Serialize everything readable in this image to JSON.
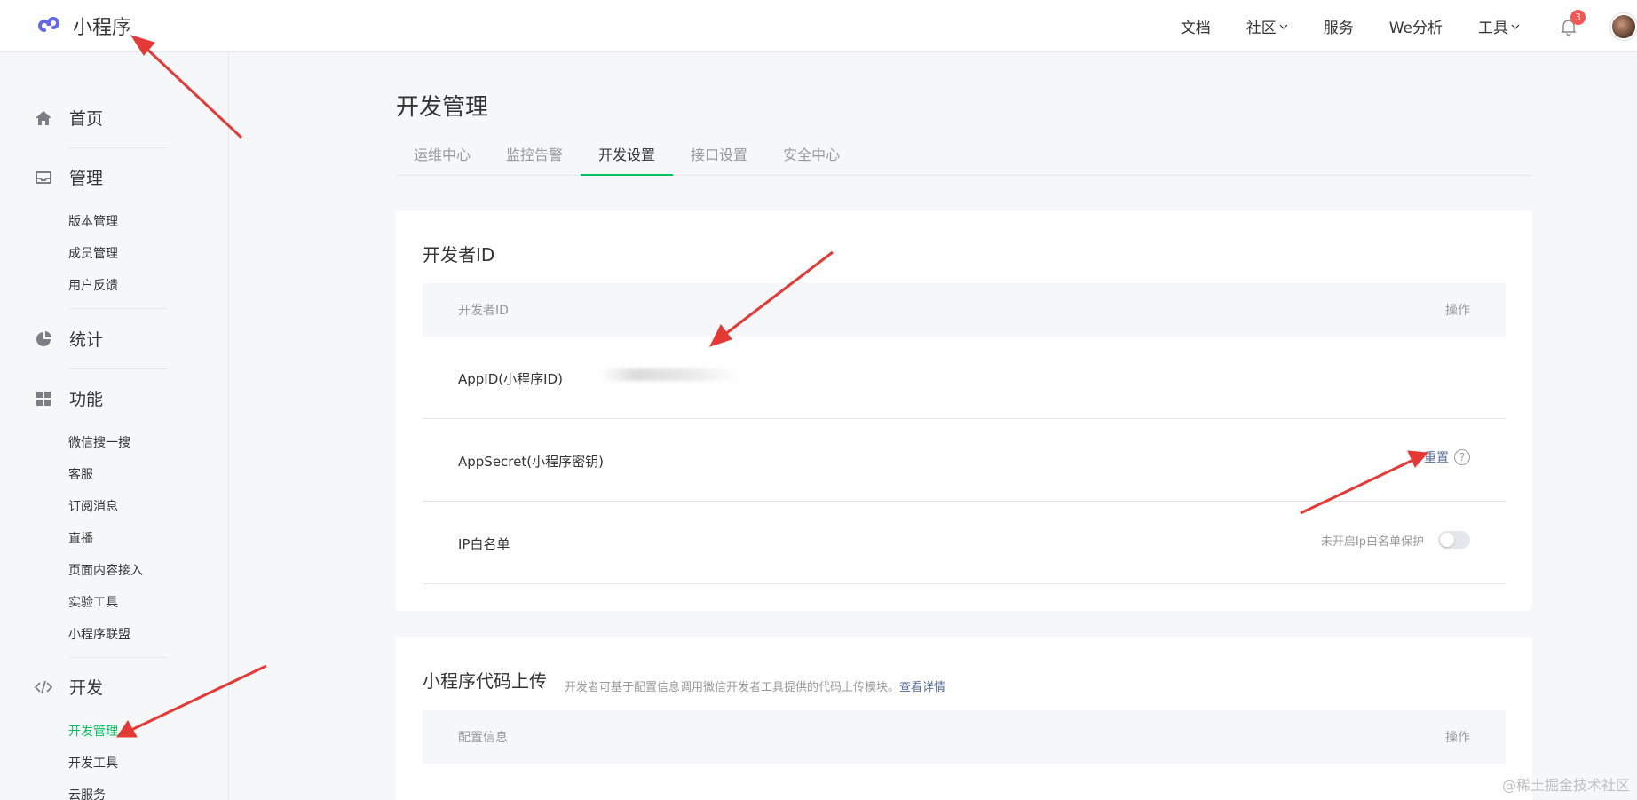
{
  "header": {
    "app_name": "小程序",
    "nav": [
      "文档",
      "社区",
      "服务",
      "We分析",
      "工具"
    ],
    "notification_count": "3"
  },
  "sidebar": {
    "home": "首页",
    "manage": {
      "label": "管理",
      "items": [
        "版本管理",
        "成员管理",
        "用户反馈"
      ]
    },
    "stats": "统计",
    "features": {
      "label": "功能",
      "items": [
        "微信搜一搜",
        "客服",
        "订阅消息",
        "直播",
        "页面内容接入",
        "实验工具",
        "小程序联盟"
      ]
    },
    "dev": {
      "label": "开发",
      "items": [
        "开发管理",
        "开发工具",
        "云服务"
      ],
      "active_index": 0
    }
  },
  "main": {
    "title": "开发管理",
    "tabs": [
      "运维中心",
      "监控告警",
      "开发设置",
      "接口设置",
      "安全中心"
    ],
    "active_tab": 2
  },
  "developer_card": {
    "title": "开发者ID",
    "col_left": "开发者ID",
    "col_right": "操作",
    "rows": {
      "appid_label": "AppID(小程序ID)",
      "secret_label": "AppSecret(小程序密钥)",
      "secret_action": "重置",
      "ip_label": "IP白名单",
      "ip_status": "未开启Ip白名单保护"
    }
  },
  "upload_card": {
    "title": "小程序代码上传",
    "desc": "开发者可基于配置信息调用微信开发者工具提供的代码上传模块。",
    "desc_link": "查看详情",
    "col_left": "配置信息",
    "col_right": "操作"
  },
  "watermark": "@稀土掘金技术社区",
  "colors": {
    "accent": "#07c160",
    "link": "#576b95",
    "badge": "#fa5151",
    "annotation": "#e53935"
  }
}
